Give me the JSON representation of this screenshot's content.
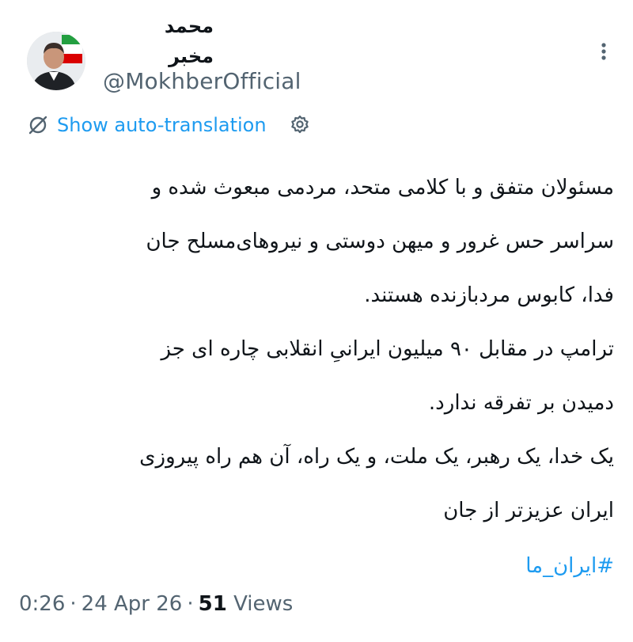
{
  "author": {
    "display_name_line1": "محمد",
    "display_name_line2": "مخبر",
    "handle": "@MokhberOfficial"
  },
  "translation": {
    "link_label": "Show auto-translation"
  },
  "tweet": {
    "lines": [
      "مسئولان متفق و با کلامی متحد، مردمی مبعوث شده و",
      "سراسر حس غرور و میهن دوستی و نیروهای‌مسلح جان",
      "فدا، کابوس مردبازنده هستند.",
      "ترامپ در مقابل ۹۰ میلیون ایرانیِ انقلابی چاره ای جز",
      "دمیدن بر تفرقه ندارد.",
      "یک خدا، یک رهبر، یک ملت، و یک راه، آن هم راه پیروزی",
      "ایران عزیزتر از جان"
    ],
    "hashtag": "#ایران_ما"
  },
  "meta": {
    "time": "0:26",
    "date": "24 Apr 26",
    "views_count": "51",
    "views_label": "Views",
    "separator": "·"
  },
  "colors": {
    "link": "#1d9bf0",
    "secondary_text": "#536471",
    "primary_text": "#0f1419"
  },
  "icons": {
    "more": "more-dots-icon",
    "translate": "translate-slash-icon",
    "settings": "gear-icon"
  }
}
